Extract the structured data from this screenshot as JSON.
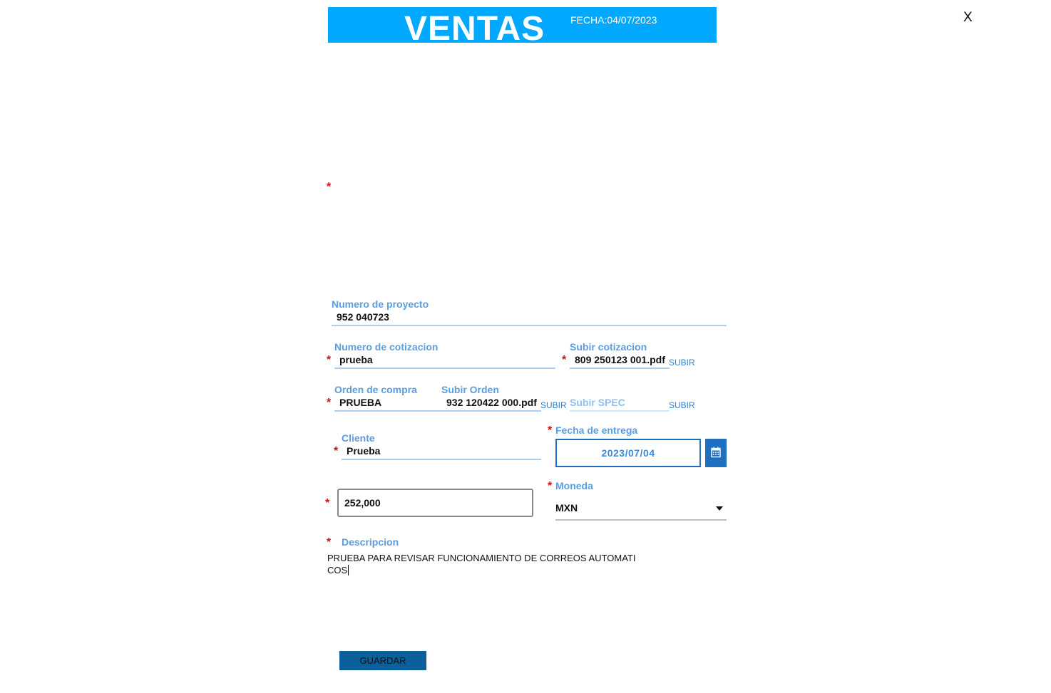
{
  "header": {
    "title": "VENTAS",
    "fecha_label": "FECHA:",
    "fecha_value": "04/07/2023",
    "color": "#00a8ff"
  },
  "close_label": "X",
  "required_mark": "*",
  "proyecto": {
    "label": "Numero de proyecto",
    "value": "952 040723"
  },
  "cotizacion": {
    "label": "Numero de cotizacion",
    "value": "prueba"
  },
  "subir_cotizacion": {
    "label": "Subir cotizacion",
    "file": "809 250123 001.pdf",
    "action": "SUBIR"
  },
  "orden": {
    "label": "Orden de compra",
    "value": "PRUEBA"
  },
  "subir_orden": {
    "label": "Subir Orden",
    "file": "932 120422 000.pdf",
    "action": "SUBIR"
  },
  "subir_spec": {
    "label": "Subir SPEC",
    "action": "SUBIR"
  },
  "cliente": {
    "label": "Cliente",
    "value": "Prueba"
  },
  "fecha_entrega": {
    "label": "Fecha de entrega",
    "value": "2023/07/04",
    "icon": "calendar-icon"
  },
  "monto": {
    "value": "252,000"
  },
  "moneda": {
    "label": "Moneda",
    "value": "MXN",
    "icon": "caret-down-icon"
  },
  "descripcion": {
    "label": "Descripcion",
    "line1": "PRUEBA PARA REVISAR FUNCIONAMIENTO DE CORREOS AUTOMATI",
    "line2": "COS"
  },
  "save_label": "GUARDAR",
  "colors": {
    "accent": "#00a8ff",
    "button": "#0b5f9a",
    "label": "#5b9de0",
    "required": "#cc1111"
  }
}
